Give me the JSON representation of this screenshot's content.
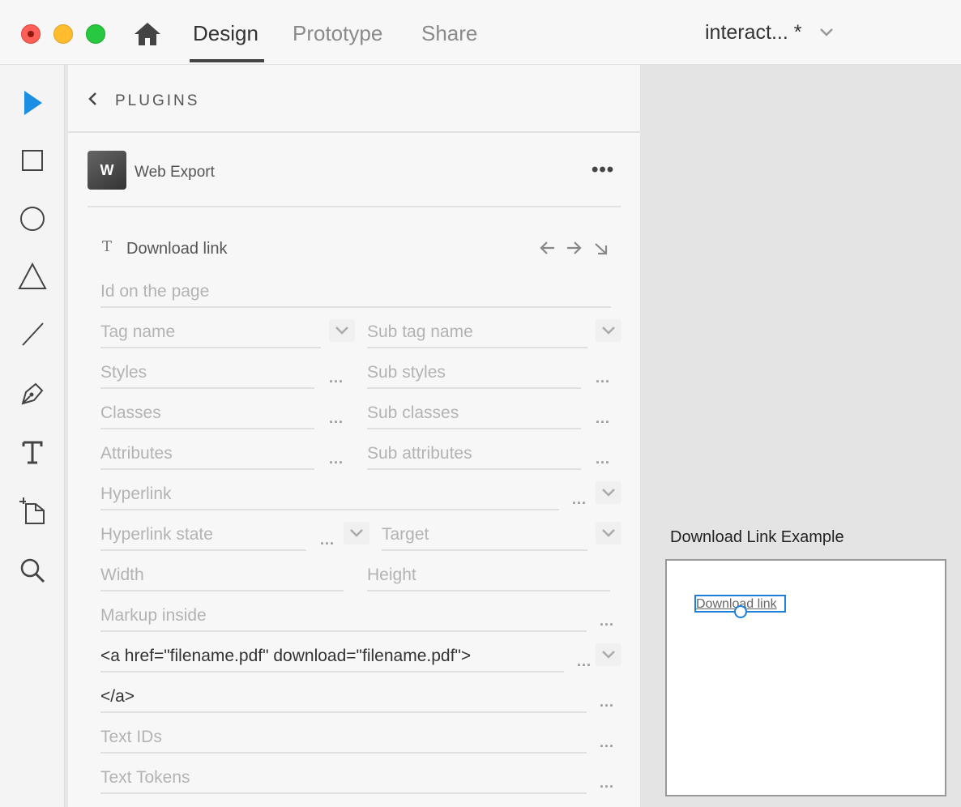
{
  "window": {
    "tabs": [
      {
        "label": "Design",
        "active": true
      },
      {
        "label": "Prototype",
        "active": false
      },
      {
        "label": "Share",
        "active": false
      }
    ],
    "doc_title": "interact... *"
  },
  "tools": [
    "select-tool",
    "rectangle-tool",
    "ellipse-tool",
    "polygon-tool",
    "line-tool",
    "pen-tool",
    "text-tool",
    "artboard-tool",
    "zoom-tool"
  ],
  "panel": {
    "title": "PLUGINS",
    "plugin": {
      "icon_letter": "W",
      "name": "Web Export",
      "more": "•••"
    },
    "element": {
      "type_glyph": "T",
      "name": "Download link"
    },
    "fields": {
      "id": "Id on the page",
      "tag": "Tag name",
      "subtag": "Sub tag name",
      "styles": "Styles",
      "substyles": "Sub styles",
      "classes": "Classes",
      "subclasses": "Sub classes",
      "attributes": "Attributes",
      "subattributes": "Sub attributes",
      "hyperlink": "Hyperlink",
      "hyperlink_state": "Hyperlink state",
      "target": "Target",
      "width": "Width",
      "height": "Height",
      "markup_inside": "Markup inside",
      "markup_before": "<a href=\"filename.pdf\" download=\"filename.pdf\">",
      "markup_after": "</a>",
      "text_ids": "Text IDs",
      "text_tokens": "Text Tokens"
    },
    "dots": "..."
  },
  "canvas": {
    "artboard_title": "Download Link Example",
    "link_text": "Download link"
  },
  "colors": {
    "accent": "#1e7fd8",
    "select_tool": "#1a8fe3"
  }
}
